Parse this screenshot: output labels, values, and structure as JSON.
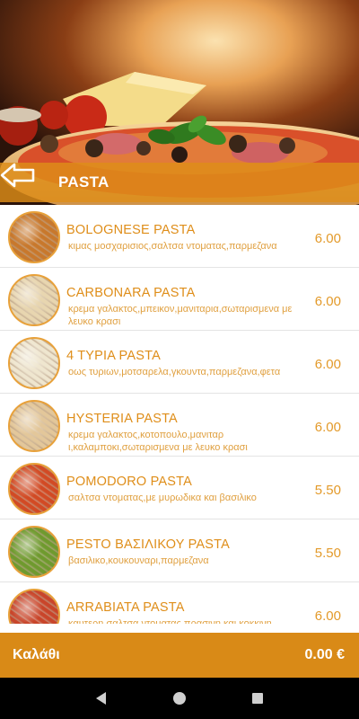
{
  "header": {
    "title": "PASTA",
    "back_icon": "arrow-left-icon"
  },
  "menu": {
    "items": [
      {
        "name": "BOLOGNESE PASTA",
        "description": "κιμας μοσχαρισιος,σαλτσα ντοματας,παρμεζανα",
        "price": "6.00",
        "thumb_color": "#c8782c"
      },
      {
        "name": "CARBONARA PASTA",
        "description": "κρεμα γαλακτος,μπεικον,μανιταρια,σωταρισμενα με λευκο κρασι",
        "price": "6.00",
        "thumb_color": "#e8d6b0"
      },
      {
        "name": "4 ΤΥΡΙΑ PASTA",
        "description": "οως τυριων,μοτσαρελα,γκουντα,παρμεζανα,φετα",
        "price": "6.00",
        "thumb_color": "#efe6cf"
      },
      {
        "name": "HYSTERIA PASTA",
        "description": "κρεμα γαλακτος,κοτοπουλο,μανιταρ ι,καλαμποκι,σωταρισμενα με λευκο κρασι",
        "price": "6.00",
        "thumb_color": "#e3c79a"
      },
      {
        "name": "POMODORO PASTA",
        "description": "σαλτσα ντοματας,με μυρωδικα και βασιλικο",
        "price": "5.50",
        "thumb_color": "#d24a24"
      },
      {
        "name": "PESTO ΒΑΣΙΛΙΚΟΥ PASTA",
        "description": "βασιλικο,κουκουναρι,παρμεζανα",
        "price": "5.50",
        "thumb_color": "#6f9a2e"
      },
      {
        "name": "ARRABIATA PASTA",
        "description": "καυτερη σαλτσα ντοματας,πρασινη και κοκκινη",
        "price": "6.00",
        "thumb_color": "#c9452a"
      }
    ]
  },
  "cart": {
    "label": "Καλάθι",
    "total": "0.00 €"
  },
  "colors": {
    "accent": "#df8e1a",
    "cart_bar": "#d98a17"
  }
}
